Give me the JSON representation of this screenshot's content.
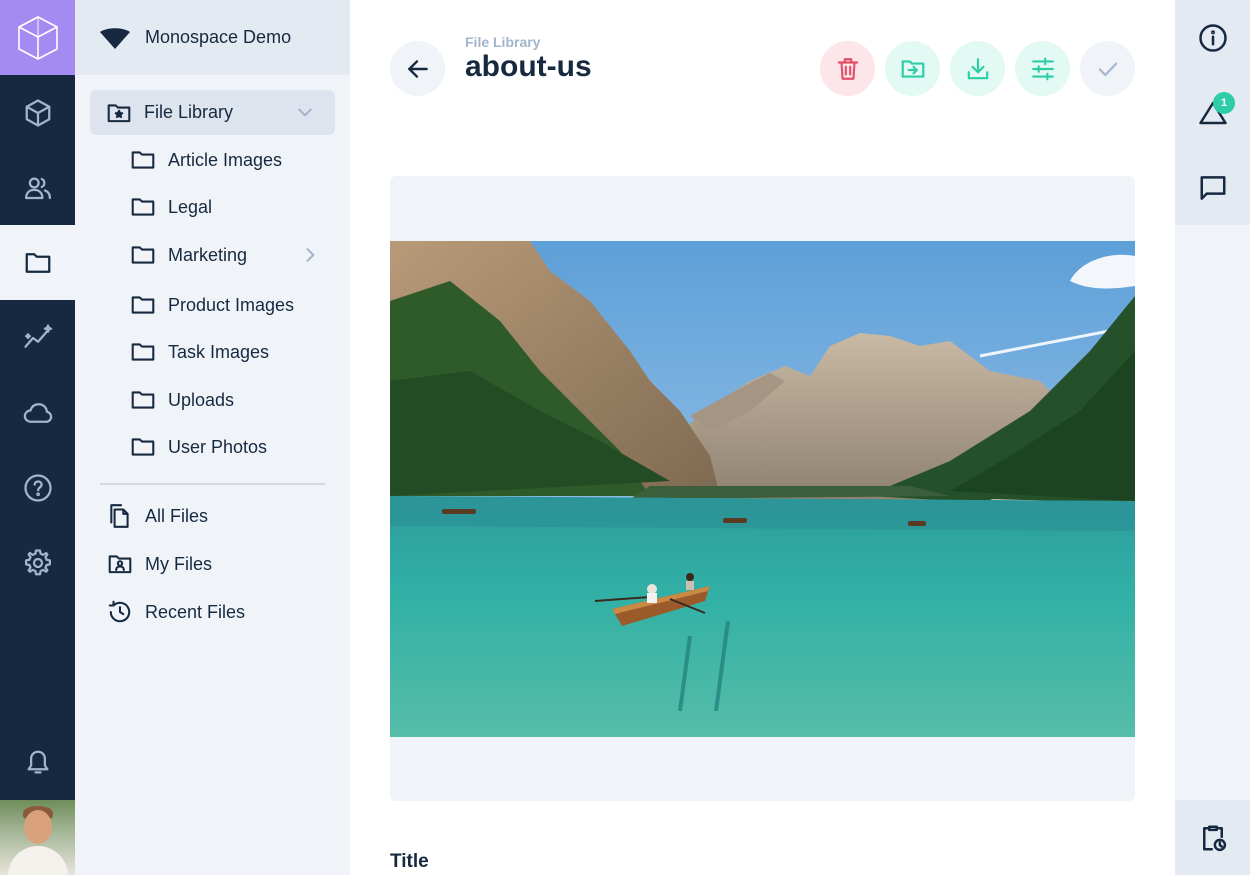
{
  "project": {
    "name": "Monospace Demo"
  },
  "modules": [
    {
      "icon": "box-icon"
    },
    {
      "icon": "users-icon"
    },
    {
      "icon": "folder-icon",
      "active": true
    },
    {
      "icon": "insights-icon"
    },
    {
      "icon": "cloud-icon"
    },
    {
      "icon": "help-icon"
    },
    {
      "icon": "settings-icon"
    }
  ],
  "nav": {
    "group_label": "File Library",
    "folders": [
      {
        "label": "Article Images"
      },
      {
        "label": "Legal"
      },
      {
        "label": "Marketing",
        "has_children": true
      },
      {
        "label": "Product Images"
      },
      {
        "label": "Task Images"
      },
      {
        "label": "Uploads"
      },
      {
        "label": "User Photos"
      }
    ],
    "special": [
      {
        "label": "All Files",
        "icon": "files-icon"
      },
      {
        "label": "My Files",
        "icon": "user-folder-icon"
      },
      {
        "label": "Recent Files",
        "icon": "history-icon"
      }
    ]
  },
  "header": {
    "breadcrumb": "File Library",
    "title": "about-us"
  },
  "actions": [
    {
      "name": "delete-button",
      "icon": "trash-icon",
      "style": "danger"
    },
    {
      "name": "move-button",
      "icon": "folder-move-icon",
      "style": "ok"
    },
    {
      "name": "download-button",
      "icon": "download-icon",
      "style": "ok"
    },
    {
      "name": "edit-image-button",
      "icon": "tune-icon",
      "style": "ok"
    },
    {
      "name": "save-button",
      "icon": "check-icon",
      "style": "save"
    }
  ],
  "form": {
    "field_label": "Title"
  },
  "sidebar": {
    "revisions_badge": "1"
  },
  "colors": {
    "module_bar": "#172940",
    "logo_bg": "#a48bf2",
    "nav_bg": "#f0f4f9",
    "danger": "#e35169",
    "success": "#2ecda7",
    "muted": "#a2b5cd"
  }
}
